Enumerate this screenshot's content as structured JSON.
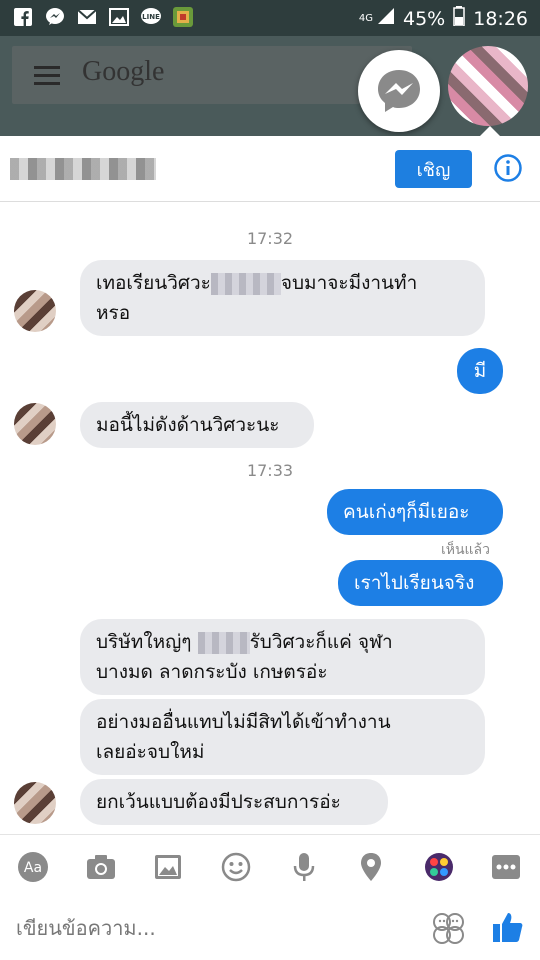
{
  "status_bar": {
    "network": "4G",
    "battery": "45%",
    "time": "18:26"
  },
  "background_app": {
    "search_label": "Google"
  },
  "header": {
    "invite_label": "เชิญ"
  },
  "messages": {
    "time_1": "17:32",
    "time_2": "17:33",
    "m1_line1_a": "เทอเรียนวิศวะ",
    "m1_line1_b": "จบมาจะมีงานทำ",
    "m1_line2": "หรอ",
    "m2": "มี",
    "m3": "มอนี้ไม่ดังด้านวิศวะนะ",
    "m4": "คนเก่งๆก็มีเยอะ",
    "seen": "เห็นแล้ว",
    "m5": "เราไปเรียนจริง",
    "m6_line1_a": "บริษัทใหญ่ๆ",
    "m6_line1_b": "รับวิศวะก็แค่ จุฬา",
    "m6_line2": "บางมด ลาดกระบัง เกษตรอ่ะ",
    "m7_line1": "อย่างมออื่นแทบไม่มีสิทได้เข้าทำงาน",
    "m7_line2": "เลยอ่ะจบใหม่",
    "m8": "ยกเว้นแบบต้องมีประสบการอ่ะ"
  },
  "toolbar": {
    "text_tool_label": "Aa",
    "icons": [
      "text-format-icon",
      "camera-icon",
      "gallery-icon",
      "emoji-icon",
      "microphone-icon",
      "location-icon",
      "games-icon",
      "more-icon"
    ]
  },
  "composer": {
    "placeholder": "เขียนข้อความ..."
  },
  "colors": {
    "accent": "#1d7fe5",
    "incoming_bubble": "#e9eaed"
  }
}
